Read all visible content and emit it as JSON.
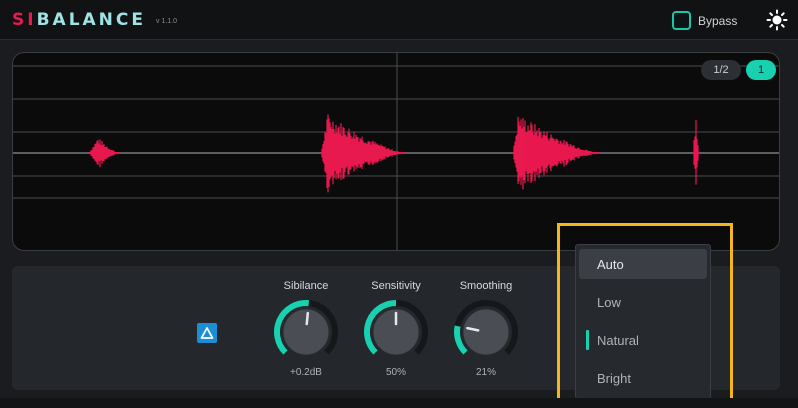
{
  "header": {
    "logo_prefix": "SI",
    "logo_rest": "BALANCE",
    "version": "v 1.1.0",
    "bypass_label": "Bypass",
    "theme_icon": "sun-icon"
  },
  "display": {
    "zoom_options": [
      "1/2",
      "1"
    ],
    "zoom_selected": "1",
    "waveform_color": "#e8194f"
  },
  "controls": {
    "delta_icon": "delta-icon",
    "knobs": [
      {
        "label": "Sibilance",
        "value": "+0.2dB",
        "level": 0.52
      },
      {
        "label": "Sensitivity",
        "value": "50%",
        "level": 0.5
      },
      {
        "label": "Smoothing",
        "value": "21%",
        "level": 0.21
      }
    ]
  },
  "dropdown": {
    "options": [
      "Auto",
      "Low",
      "Natural",
      "Bright"
    ],
    "hovered": "Auto",
    "selected": "Natural"
  },
  "colors": {
    "accent": "#17d1b0",
    "brand": "#e8194f",
    "highlight": "#f3b61b"
  }
}
